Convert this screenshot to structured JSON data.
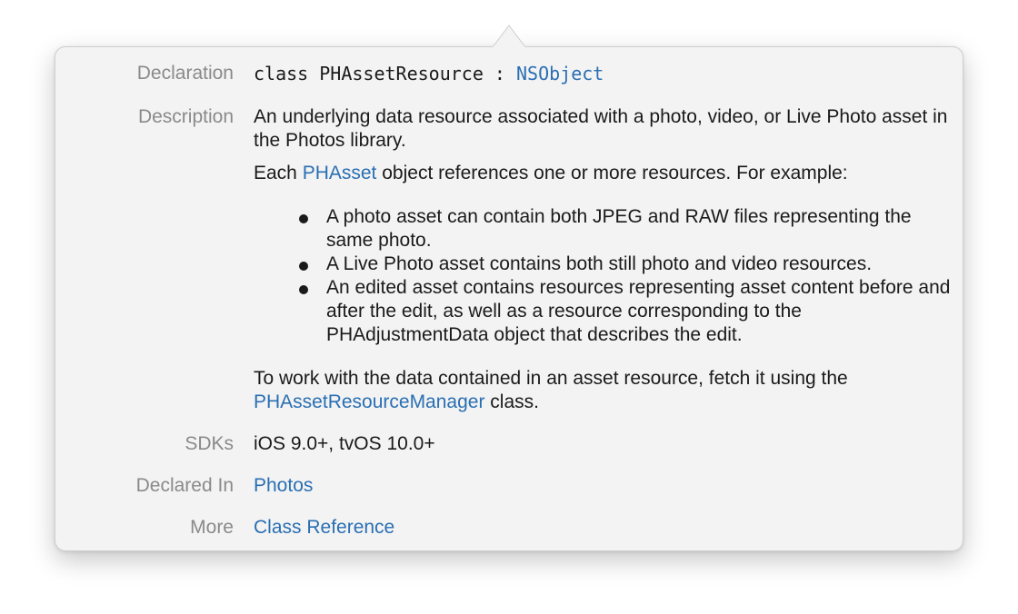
{
  "declaration": {
    "label": "Declaration",
    "code_prefix": "class PHAssetResource : ",
    "code_link": "NSObject"
  },
  "description": {
    "label": "Description",
    "para1": "An underlying data resource associated with a photo, video, or Live Photo asset in the Photos library.",
    "para2_prefix": "Each ",
    "para2_link": "PHAsset",
    "para2_suffix": " object references one or more resources. For example:",
    "bullets": [
      "A photo asset can contain both JPEG and RAW files representing the same photo.",
      "A Live Photo asset contains both still photo and video resources.",
      "An edited asset contains resources representing asset content before and after the edit, as well as a resource corresponding to the PHAdjustmentData object that describes the edit."
    ],
    "para3_prefix": "To work with the data contained in an asset resource, fetch it using the ",
    "para3_link": "PHAssetResourceManager",
    "para3_suffix": " class."
  },
  "sdks": {
    "label": "SDKs",
    "value": "iOS 9.0+, tvOS 10.0+"
  },
  "declared_in": {
    "label": "Declared In",
    "link": "Photos"
  },
  "more": {
    "label": "More",
    "link": "Class Reference"
  },
  "colors": {
    "link": "#2a6fb3",
    "label": "#8a8a8a",
    "background": "#f3f3f3"
  }
}
